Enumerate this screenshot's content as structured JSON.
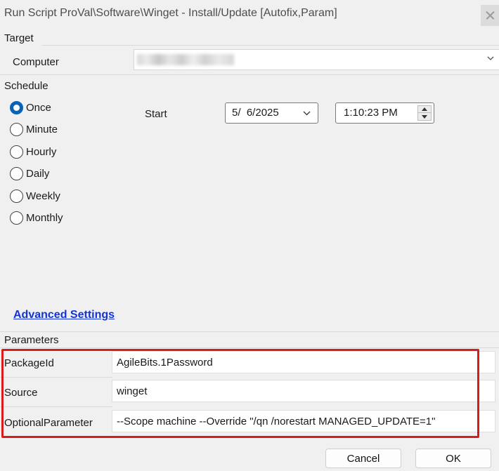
{
  "window": {
    "title": "Run Script ProVal\\Software\\Winget - Install/Update [Autofix,Param]"
  },
  "target": {
    "section": "Target",
    "computer_label": "Computer"
  },
  "schedule": {
    "section": "Schedule",
    "options": [
      "Once",
      "Minute",
      "Hourly",
      "Daily",
      "Weekly",
      "Monthly"
    ],
    "selected": "Once",
    "start_label": "Start",
    "date": "5/  6/2025",
    "time": "1:10:23 PM"
  },
  "advanced": {
    "link": "Advanced Settings"
  },
  "parameters": {
    "section": "Parameters",
    "rows": [
      {
        "name": "PackageId",
        "value": "AgileBits.1Password"
      },
      {
        "name": "Source",
        "value": "winget"
      },
      {
        "name": "OptionalParameter",
        "value": "--Scope machine --Override \"/qn /norestart MANAGED_UPDATE=1\""
      }
    ]
  },
  "buttons": {
    "cancel": "Cancel",
    "ok": "OK"
  },
  "colors": {
    "radio_accent": "#0a62b6",
    "link": "#1333d6",
    "highlight": "#d81b1b"
  },
  "icons": {
    "close": "close-icon",
    "dropdown": "chevron-down-icon",
    "spin": "spin-arrows-icon"
  }
}
